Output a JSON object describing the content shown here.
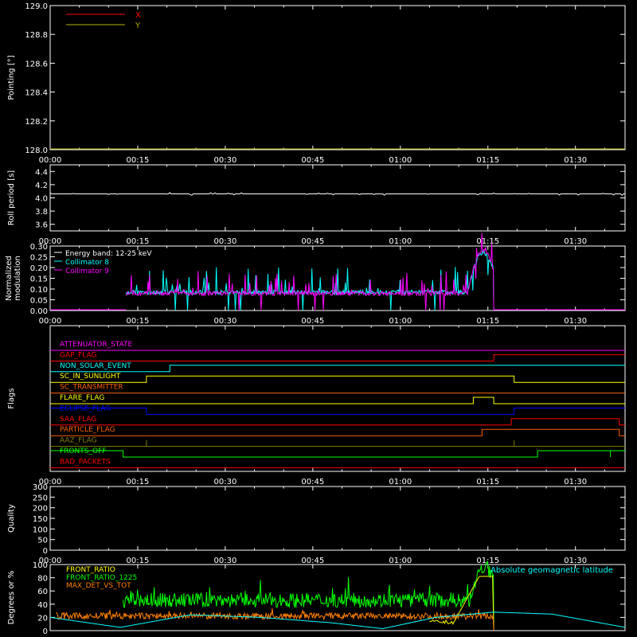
{
  "chart_data": [
    {
      "id": "pointing",
      "type": "line",
      "ylabel": "Pointing [°]",
      "ylim": [
        128.0,
        129.0
      ],
      "yticks": [
        "128.0",
        "128.2",
        "128.4",
        "128.6",
        "128.8",
        "129.0"
      ],
      "xticks": [
        "00:00",
        "00:15",
        "00:30",
        "00:45",
        "01:00",
        "01:15",
        "01:30"
      ],
      "legend": [
        {
          "name": "X",
          "color": "#ff0000"
        },
        {
          "name": "Y",
          "color": "#b3b300"
        }
      ],
      "series": [
        {
          "name": "Y",
          "color": "#b3b300",
          "x": [
            0,
            98.5
          ],
          "y": [
            128.0,
            128.0
          ]
        }
      ]
    },
    {
      "id": "roll",
      "type": "line",
      "ylabel": "Roll period [s]",
      "ylim": [
        3.5,
        4.5
      ],
      "yticks": [
        "3.6",
        "3.8",
        "4.0",
        "4.2",
        "4.4"
      ],
      "xticks": [
        "00:00",
        "00:15",
        "00:30",
        "00:45",
        "01:00",
        "01:15",
        "01:30"
      ],
      "series": [
        {
          "name": "Roll period",
          "color": "#ffffff",
          "x": [
            0,
            98.5
          ],
          "y": [
            4.06,
            4.06
          ]
        }
      ]
    },
    {
      "id": "modulation",
      "type": "line",
      "ylabel_lines": [
        "Normalized",
        "modulation"
      ],
      "ylim": [
        0.0,
        0.3
      ],
      "yticks": [
        "0.00",
        "0.05",
        "0.10",
        "0.15",
        "0.20",
        "0.25",
        "0.30"
      ],
      "xticks": [
        "00:00",
        "00:15",
        "00:30",
        "00:45",
        "01:00",
        "01:15",
        "01:30"
      ],
      "legend": [
        {
          "name": "Energy band: 12-25 keV",
          "color": "#ffffff"
        },
        {
          "name": "Collimator 8",
          "color": "#00ffff"
        },
        {
          "name": "Collimator 9",
          "color": "#ff00ff"
        }
      ],
      "series": [
        {
          "name": "Collimator 8",
          "color": "#00ffff",
          "x_range": [
            13,
            76
          ],
          "baseline": 0.085,
          "peak": 0.27
        },
        {
          "name": "Collimator 9",
          "color": "#ff00ff",
          "x_range": [
            13,
            76
          ],
          "baseline": 0.08,
          "peak": 0.28
        }
      ]
    },
    {
      "id": "flags",
      "type": "line",
      "ylabel": "Flags",
      "xticks": [
        "00:00",
        "00:15",
        "00:30",
        "00:45",
        "01:00",
        "01:15",
        "01:30"
      ],
      "flags": [
        {
          "name": "ATTENUATOR_STATE",
          "color": "#ff00ff",
          "steps": [
            [
              0,
              0
            ]
          ]
        },
        {
          "name": "GAP_FLAG",
          "color": "#ff0000",
          "steps": [
            [
              0,
              0
            ],
            [
              76,
              1
            ]
          ]
        },
        {
          "name": "NON_SOLAR_EVENT",
          "color": "#00ffff",
          "steps": [
            [
              0,
              0
            ],
            [
              20.5,
              1
            ]
          ]
        },
        {
          "name": "SC_IN_SUNLIGHT",
          "color": "#ffff00",
          "steps": [
            [
              0,
              0
            ],
            [
              16.5,
              1
            ],
            [
              79.5,
              0
            ]
          ]
        },
        {
          "name": "SC_TRANSMITTER",
          "color": "#ff6000",
          "steps": [
            [
              0,
              0
            ]
          ]
        },
        {
          "name": "FLARE_FLAG",
          "color": "#ffff00",
          "steps": [
            [
              0,
              0
            ],
            [
              72.5,
              1
            ],
            [
              76,
              0
            ]
          ]
        },
        {
          "name": "ECLIPSE_FLAG",
          "color": "#0000ff",
          "steps": [
            [
              0,
              1
            ],
            [
              16.5,
              0
            ],
            [
              79.5,
              1
            ]
          ]
        },
        {
          "name": "SAA_FLAG",
          "color": "#ff0000",
          "steps": [
            [
              0,
              0
            ],
            [
              79,
              1
            ],
            [
              97.5,
              0
            ]
          ]
        },
        {
          "name": "PARTICLE_FLAG",
          "color": "#ff6000",
          "steps": [
            [
              0,
              0
            ],
            [
              74,
              1
            ],
            [
              97.5,
              0
            ]
          ]
        },
        {
          "name": "AAZ_FLAG",
          "color": "#808000",
          "pulses": [
            16.5,
            79.5
          ],
          "steps": [
            [
              0,
              0
            ]
          ]
        },
        {
          "name": "FRONTS_OFF",
          "color": "#00ff00",
          "steps": [
            [
              0,
              1
            ],
            [
              12.5,
              0
            ],
            [
              83.5,
              1
            ]
          ],
          "pulses": [
            96
          ]
        },
        {
          "name": "BAD_PACKETS",
          "color": "#ff0000",
          "steps": [
            [
              0,
              0
            ]
          ]
        }
      ]
    },
    {
      "id": "quality",
      "type": "line",
      "ylabel": "Quality",
      "ylim": [
        0,
        300
      ],
      "yticks": [
        "0",
        "50",
        "100",
        "150",
        "200",
        "250",
        "300"
      ],
      "xticks": [
        "00:00",
        "00:15",
        "00:30",
        "00:45",
        "01:00",
        "01:15",
        "01:30"
      ],
      "series": [
        {
          "name": "Quality",
          "color": "#ffffff",
          "x": [
            0,
            98.5
          ],
          "y": [
            0,
            0
          ]
        }
      ]
    },
    {
      "id": "ratios",
      "type": "line",
      "ylabel": "Degrees or %",
      "ylim": [
        0,
        100
      ],
      "yticks": [
        "0",
        "20",
        "40",
        "60",
        "80",
        "100"
      ],
      "legend": [
        {
          "name": "FRONT_RATIO",
          "color": "#ffff00"
        },
        {
          "name": "FRONT_RATIO_1225",
          "color": "#00ff00"
        },
        {
          "name": "MAX_DET_VS_TOT",
          "color": "#ff8000"
        }
      ],
      "annotation": {
        "text": "Absolute geomagnetic latitude",
        "color": "#00ffff"
      },
      "series": [
        {
          "name": "FRONT_RATIO_1225",
          "color": "#00ff00",
          "x_range": [
            12.5,
            76
          ],
          "baseline": 46,
          "peak": 97
        },
        {
          "name": "FRONT_RATIO",
          "color": "#ffff00",
          "x_range": [
            65,
            76
          ],
          "baseline": 10,
          "peak": 82
        },
        {
          "name": "MAX_DET_VS_TOT",
          "color": "#ff8000",
          "x_range": [
            1,
            76
          ],
          "baseline": 22,
          "peak": 30
        },
        {
          "name": "Absolute geomagnetic latitude",
          "color": "#00ffff",
          "x": [
            0,
            12,
            24,
            36,
            48,
            57,
            66,
            76,
            86,
            98.5
          ],
          "y": [
            20,
            5,
            24,
            20,
            12,
            3,
            20,
            28,
            25,
            5
          ]
        }
      ]
    }
  ]
}
